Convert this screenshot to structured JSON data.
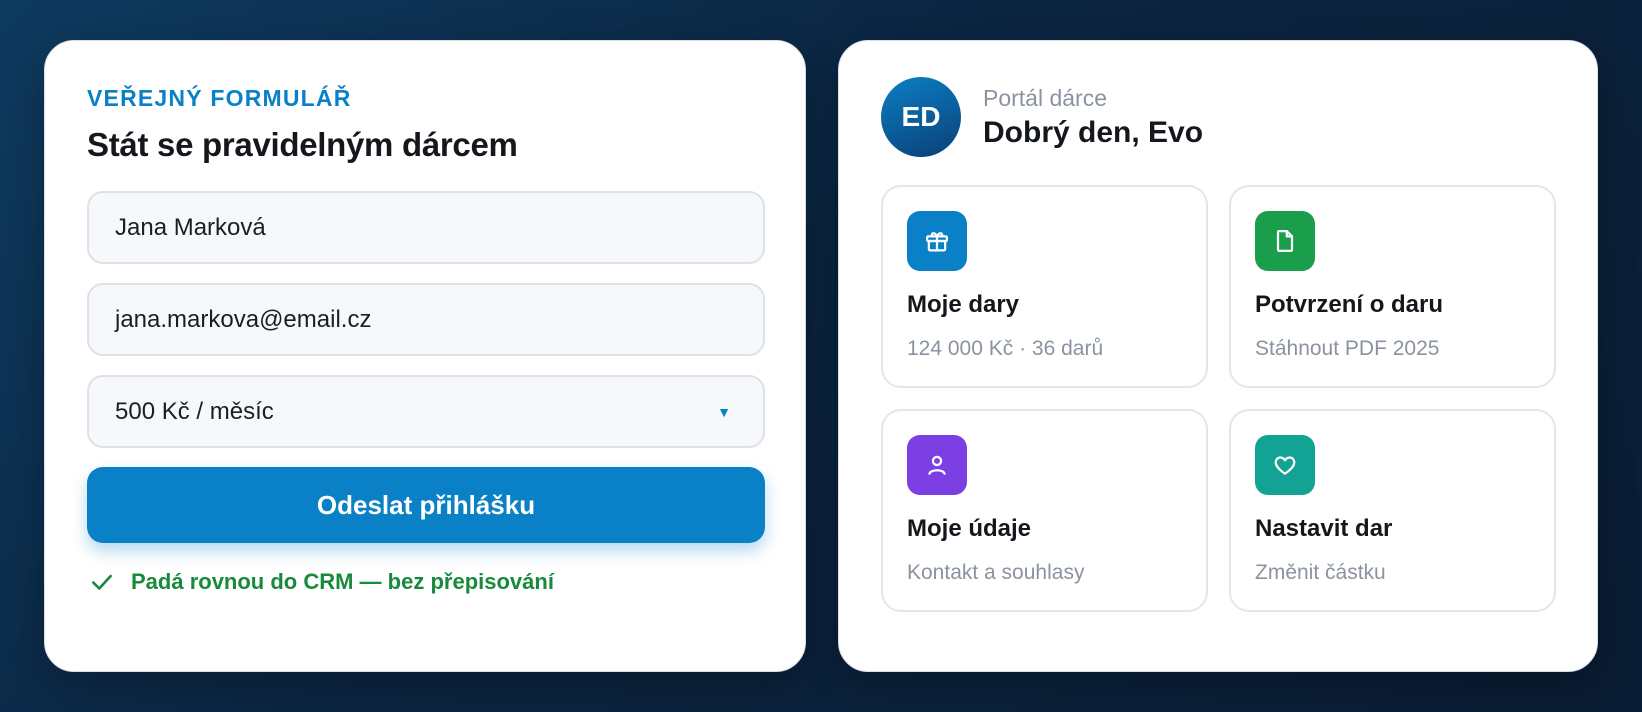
{
  "form": {
    "eyebrow": "VEŘEJNÝ FORMULÁŘ",
    "title": "Stát se pravidelným dárcem",
    "name_value": "Jana Marková",
    "email_value": "jana.markova@email.cz",
    "amount_value": "500 Kč / měsíc",
    "submit_label": "Odeslat přihlášku",
    "note": "Padá rovnou do CRM — bez přepisování"
  },
  "portal": {
    "avatar_initials": "ED",
    "subtitle": "Portál dárce",
    "greeting": "Dobrý den, Evo",
    "tiles": [
      {
        "title": "Moje dary",
        "subtitle": "124 000 Kč · 36 darů",
        "icon": "gift-icon",
        "color": "#0a80c6"
      },
      {
        "title": "Potvrzení o daru",
        "subtitle": "Stáhnout PDF 2025",
        "icon": "document-icon",
        "color": "#1a9e4b"
      },
      {
        "title": "Moje údaje",
        "subtitle": "Kontakt a souhlasy",
        "icon": "user-icon",
        "color": "#7b3fe4"
      },
      {
        "title": "Nastavit dar",
        "subtitle": "Změnit částku",
        "icon": "heart-icon",
        "color": "#12a394"
      }
    ]
  },
  "colors": {
    "accent": "#0a80c6",
    "success": "#178a3c",
    "background": "#0b2440"
  }
}
